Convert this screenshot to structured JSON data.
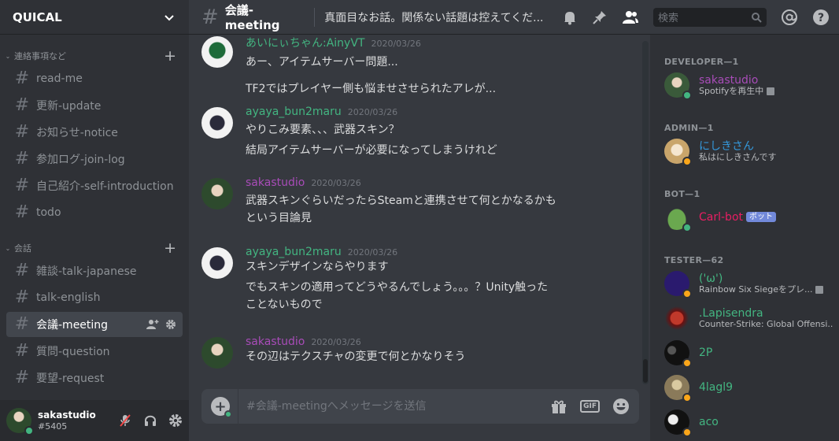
{
  "server": {
    "name": "QUICAL"
  },
  "sidebar": {
    "categories": [
      {
        "label": "連絡事項など",
        "channels": [
          "read-me",
          "更新-update",
          "お知らせ-notice",
          "参加ログ-join-log",
          "自己紹介-self-introduction",
          "todo"
        ]
      },
      {
        "label": "会話",
        "channels": [
          "雑談-talk-japanese",
          "talk-english",
          "会議-meeting",
          "質問-question",
          "要望-request"
        ]
      }
    ],
    "active_channel": "会議-meeting"
  },
  "user": {
    "name": "sakastudio",
    "discriminator": "#5405"
  },
  "header": {
    "channel": "会議-meeting",
    "topic": "真面目なお話。関係ない話題は控えてくだ...",
    "search_placeholder": "検索"
  },
  "messages": [
    {
      "author": "あいにぃちゃん:AinyVT",
      "author_color": "#43b581",
      "time": "2020/03/26",
      "lines": [
        "あー、アイテムサーバー問題...",
        "TF2ではプレイヤー側も悩ませさせられたアレが..."
      ]
    },
    {
      "author": "ayaya_bun2maru",
      "author_color": "#43b581",
      "time": "2020/03/26",
      "lines": [
        "やりこみ要素、、、武器スキン？",
        "結局アイテムサーバーが必要になってしまうけれど"
      ]
    },
    {
      "author": "sakastudio",
      "author_color": "#a84cb8",
      "time": "2020/03/26",
      "lines": [
        "武器スキンぐらいだったらSteamと連携させて何とかなるかも",
        "という目論見"
      ]
    },
    {
      "author": "ayaya_bun2maru",
      "author_color": "#43b581",
      "time": "2020/03/26",
      "lines": [
        "スキンデザインならやります",
        "でもスキンの適用ってどうやるんでしょう。。。？Unity触った",
        "ことないもので"
      ]
    },
    {
      "author": "sakastudio",
      "author_color": "#a84cb8",
      "time": "2020/03/26",
      "lines": [
        "その辺はテクスチャの変更で何とかなりそう"
      ]
    }
  ],
  "composer": {
    "placeholder": "#会議-meetingへメッセージを送信",
    "gif_label": "GIF"
  },
  "members": {
    "groups": [
      {
        "label": "DEVELOPER—1"
      },
      {
        "label": "ADMIN—1"
      },
      {
        "label": "BOT—1"
      },
      {
        "label": "TESTER—62"
      }
    ],
    "list": [
      {
        "name": "sakastudio",
        "color": "#a84cb8",
        "activity": "Spotifyを再生中",
        "status": "online",
        "status_color": "#43b581",
        "avatar_color": "#3a5a3a",
        "rich": true
      },
      {
        "name": "にしきさん",
        "color": "#3498db",
        "activity": "私はにしきさんです",
        "status": "idle",
        "status_color": "#faa61a",
        "avatar_color": "#c9a56b"
      },
      {
        "name": "Carl-bot",
        "color": "#e91e63",
        "badge": "ボット",
        "status": "online",
        "status_color": "#43b581",
        "avatar_color": "#6aa84f"
      },
      {
        "name": "('ω')",
        "color": "#43b581",
        "activity": "Rainbow Six Siegeをプレ...",
        "status": "idle",
        "status_color": "#faa61a",
        "avatar_color": "#2a1a6e",
        "rich": true
      },
      {
        "name": ".Lapisendra",
        "color": "#43b581",
        "activity": "Counter-Strike: Global Offensi...",
        "status": "none",
        "status_color": "#2f3136",
        "avatar_color": "#8b1a1a",
        "rich": true
      },
      {
        "name": "2P",
        "color": "#43b581",
        "status": "idle",
        "status_color": "#faa61a",
        "avatar_color": "#1a1a1a"
      },
      {
        "name": "4lagl9",
        "color": "#43b581",
        "status": "idle",
        "status_color": "#faa61a",
        "avatar_color": "#8a7a5a"
      },
      {
        "name": "aco",
        "color": "#43b581",
        "status": "idle",
        "status_color": "#faa61a",
        "avatar_color": "#111111"
      }
    ]
  }
}
